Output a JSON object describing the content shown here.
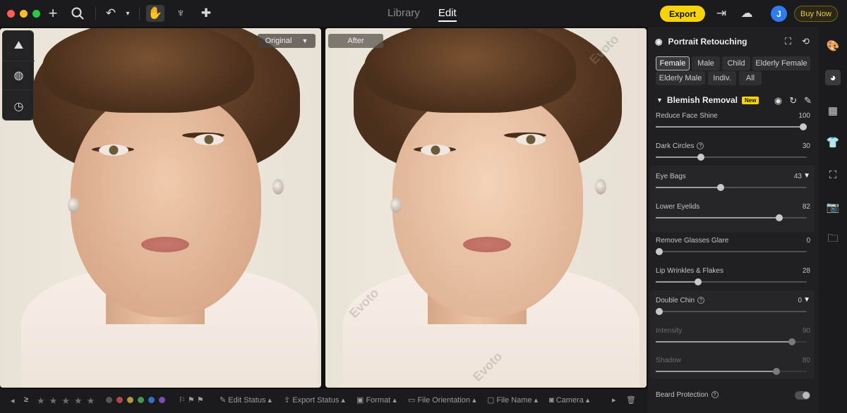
{
  "app": {
    "title_tabs": [
      "Library",
      "Edit"
    ],
    "active_tab": "Edit",
    "export_label": "Export",
    "avatar_initial": "J",
    "buy_label": "Buy Now",
    "accent": "#f7d308"
  },
  "canvas": {
    "original_label": "Original",
    "after_label": "After",
    "watermark": "Evoto"
  },
  "bottombar": {
    "color_labels": [
      "#555558",
      "#b34646",
      "#b09a3a",
      "#3f9a4f",
      "#3a6fc2",
      "#7a4fb8"
    ],
    "filters": [
      "Edit Status",
      "Export Status",
      "Format",
      "File Orientation",
      "File Name",
      "Camera"
    ]
  },
  "panel": {
    "title": "Portrait Retouching",
    "chips": [
      "Female",
      "Male",
      "Child",
      "Elderly Female",
      "Elderly Male",
      "Indiv.",
      "All"
    ],
    "active_chip": "Female",
    "section_title": "Blemish Removal",
    "new_badge": "New",
    "sliders": {
      "reduce_face_shine": {
        "label": "Reduce Face Shine",
        "value": "100",
        "level": 100
      },
      "dark_circles": {
        "label": "Dark Circles",
        "value": "30",
        "level": 30
      },
      "eye_bags": {
        "label": "Eye Bags",
        "value": "43",
        "level": 43
      },
      "lower_eyelids": {
        "label": "Lower Eyelids",
        "value": "82",
        "level": 82
      },
      "remove_glasses_glare": {
        "label": "Remove Glasses Glare",
        "value": "0",
        "level": 0
      },
      "lip_wrinkles": {
        "label": "Lip Wrinkles & Flakes",
        "value": "28",
        "level": 28
      },
      "double_chin": {
        "label": "Double Chin",
        "value": "0",
        "level": 0
      },
      "intensity": {
        "label": "Intensity",
        "value": "90",
        "level": 90
      },
      "shadow": {
        "label": "Shadow",
        "value": "80",
        "level": 80
      }
    },
    "beard_protection": "Beard Protection"
  }
}
